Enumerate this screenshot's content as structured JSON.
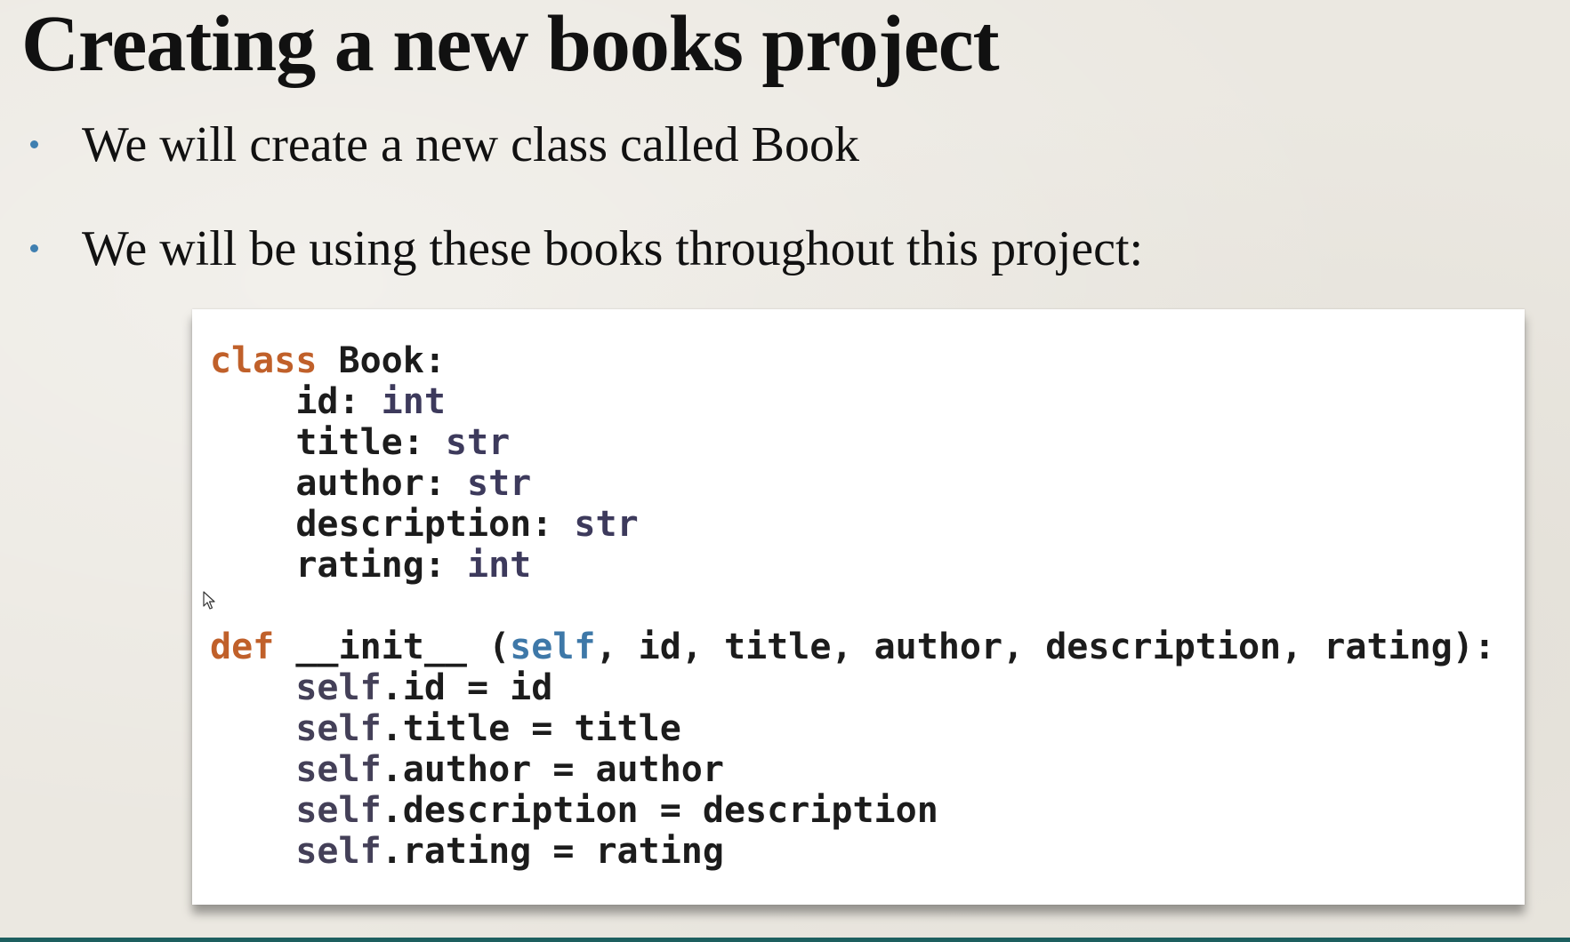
{
  "slide": {
    "title": "Creating a new books project",
    "bullets": [
      "We will create a new class called Book",
      "We will be using these books throughout this project:"
    ]
  },
  "code": {
    "class_keyword": "class",
    "class_name": "Book:",
    "fields": [
      {
        "name": "id: ",
        "type": "int"
      },
      {
        "name": "title: ",
        "type": "str"
      },
      {
        "name": "author: ",
        "type": "str"
      },
      {
        "name": "description: ",
        "type": "str"
      },
      {
        "name": "rating: ",
        "type": "int"
      }
    ],
    "def_keyword": "def",
    "init_name": "__init__",
    "init_open": " (",
    "init_self": "self",
    "init_params": ", id, title, author, description, rating):",
    "self_keyword": "self",
    "assignments": [
      ".id = id",
      ".title = title",
      ".author = author",
      ".description = description",
      ".rating = rating"
    ]
  },
  "icons": {
    "cursor": "mouse-pointer-icon",
    "bullet": "bullet-dot-icon"
  },
  "colors": {
    "keyword": "#c0602a",
    "type": "#3d3a5c",
    "self_param": "#3e78a8",
    "self_attr": "#444058",
    "bullet": "#3f7fb0",
    "bottom_strip": "#1d5f5f"
  }
}
